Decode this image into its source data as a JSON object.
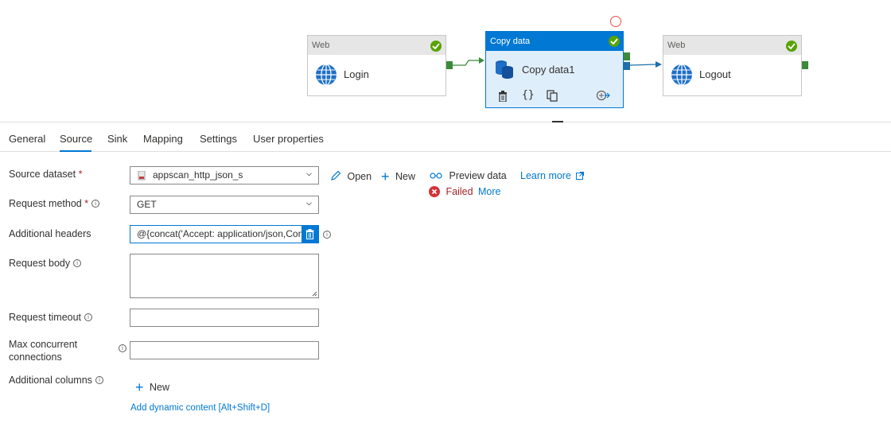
{
  "pipeline": {
    "activities": [
      {
        "type": "Web",
        "name": "Login"
      },
      {
        "type": "Copy data",
        "name": "Copy data1"
      },
      {
        "type": "Web",
        "name": "Logout"
      }
    ],
    "copy_actions": {
      "delete": "delete-icon",
      "code": "{}",
      "copy": "copy-icon",
      "output": "output-icon"
    }
  },
  "tabs": [
    "General",
    "Source",
    "Sink",
    "Mapping",
    "Settings",
    "User properties"
  ],
  "active_tab": "Source",
  "source": {
    "dataset_label": "Source dataset",
    "dataset_value": "appscan_http_json_s",
    "open_label": "Open",
    "new_label": "New",
    "preview_label": "Preview data",
    "learn_more_label": "Learn more",
    "failed_label": "Failed",
    "more_label": "More",
    "request_method_label": "Request method",
    "request_method_value": "GET",
    "additional_headers_label": "Additional headers",
    "additional_headers_value": "@{concat('Accept: application/json,Conte",
    "request_body_label": "Request body",
    "request_timeout_label": "Request timeout",
    "max_concurrent_label_1": "Max concurrent",
    "max_concurrent_label_2": "connections",
    "additional_columns_label": "Additional columns",
    "columns_new_label": "New",
    "dynamic_content_label": "Add dynamic content [Alt+Shift+D]"
  },
  "colors": {
    "accent": "#0078d4",
    "success": "#57a300",
    "error": "#d13438",
    "port": "#3a8a3a"
  }
}
